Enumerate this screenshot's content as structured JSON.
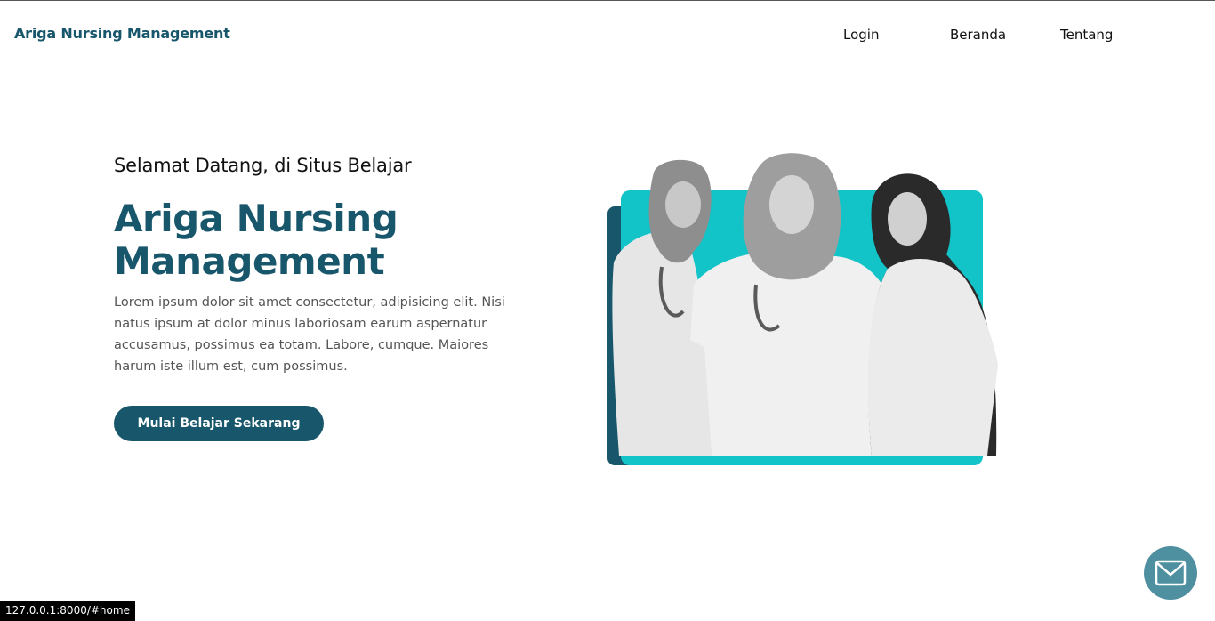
{
  "brand": "Ariga Nursing Management",
  "nav": {
    "login": "Login",
    "beranda": "Beranda",
    "tentang": "Tentang"
  },
  "hero": {
    "subtitle": "Selamat Datang, di Situs Belajar",
    "title": "Ariga Nursing Management",
    "description": "Lorem ipsum dolor sit amet consectetur, adipisicing elit. Nisi natus ipsum at dolor minus laboriosam earum aspernatur accusamus, possimus ea totam. Labore, cumque. Maiores harum iste illum est, cum possimus.",
    "cta": "Mulai Belajar Sekarang"
  },
  "status_url": "127.0.0.1:8000/#home",
  "colors": {
    "brand": "#17566b",
    "teal": "#12c3c8",
    "fab": "#4e8fa0"
  },
  "icons": {
    "fab": "mail-icon"
  }
}
